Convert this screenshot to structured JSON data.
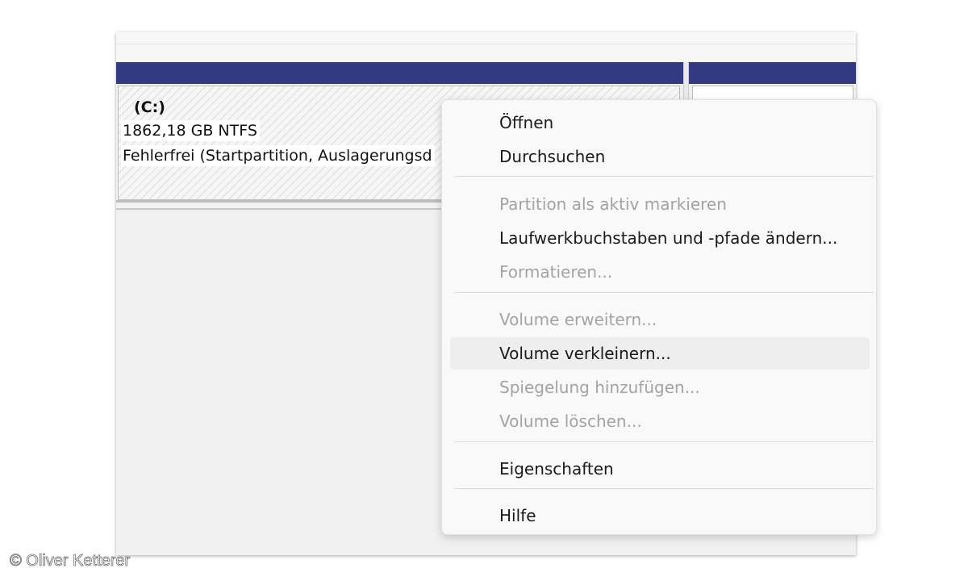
{
  "partition": {
    "name": "(C:)",
    "size": "1862,18 GB NTFS",
    "status": "Fehlerfrei (Startpartition, Auslagerungsd"
  },
  "context_menu": {
    "items": [
      {
        "label": "Öffnen",
        "enabled": true
      },
      {
        "label": "Durchsuchen",
        "enabled": true
      },
      {
        "label": "Partition als aktiv markieren",
        "enabled": false
      },
      {
        "label": "Laufwerkbuchstaben und -pfade ändern...",
        "enabled": true
      },
      {
        "label": "Formatieren...",
        "enabled": false
      },
      {
        "label": "Volume erweitern...",
        "enabled": false
      },
      {
        "label": "Volume verkleinern...",
        "enabled": true,
        "highlighted": true
      },
      {
        "label": "Spiegelung hinzufügen...",
        "enabled": false
      },
      {
        "label": "Volume löschen...",
        "enabled": false
      },
      {
        "label": "Eigenschaften",
        "enabled": true
      },
      {
        "label": "Hilfe",
        "enabled": true
      }
    ]
  },
  "watermark": "© Oliver Ketterer",
  "colors": {
    "header_band": "#333a82",
    "menu_background": "#f9f9f9",
    "disabled_text": "#a3a3a3",
    "highlight": "#eeeeee"
  }
}
